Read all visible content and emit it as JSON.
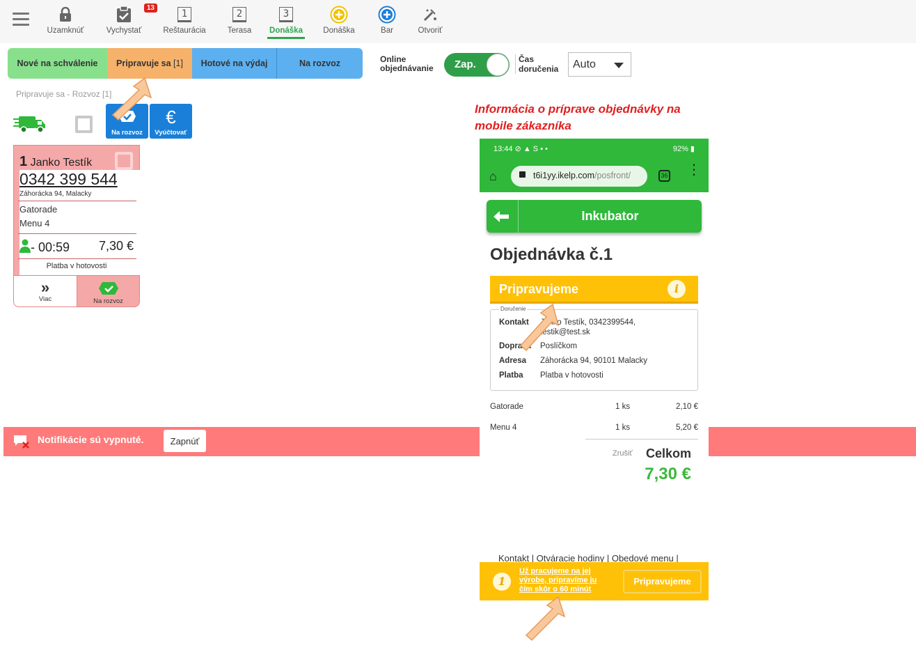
{
  "toolbar": {
    "items": [
      {
        "label": "Uzamknúť",
        "icon": "lock-icon"
      },
      {
        "label": "Vychystať",
        "icon": "clipboard-check-icon",
        "badge": "13"
      },
      {
        "label": "Reštaurácia",
        "icon": "table-1-icon",
        "num": "1"
      },
      {
        "label": "Terasa",
        "icon": "table-2-icon",
        "num": "2"
      },
      {
        "label": "Donáška",
        "icon": "table-3-icon",
        "num": "3"
      },
      {
        "label": "Donáška",
        "icon": "plus-yellow-icon"
      },
      {
        "label": "Bar",
        "icon": "plus-blue-icon"
      },
      {
        "label": "Otvoriť",
        "icon": "open-icon"
      }
    ]
  },
  "tabs": {
    "new": "Nové na schválenie",
    "prep": "Pripravuje sa",
    "prep_count": "[1]",
    "ready": "Hotové na výdaj",
    "delivery": "Na rozvoz"
  },
  "online": {
    "label_line1": "Online",
    "label_line2": "objednávanie",
    "toggle": "Zap."
  },
  "delivery_time": {
    "label_line1": "Čas",
    "label_line2": "doručenia",
    "value": "Auto"
  },
  "section_title": "Pripravuje sa - Rozvoz [1]",
  "actions": {
    "to_delivery": "Na rozvoz",
    "settle": "Vyúčtovať"
  },
  "order": {
    "number": "1",
    "name": "Janko Testík",
    "phone": "0342 399 544",
    "address": "Záhorácka 94, Malacky",
    "items": [
      "Gatorade",
      "Menu 4"
    ],
    "time": "- 00:59",
    "price": "7,30 €",
    "payment": "Platba v hotovosti",
    "more_btn": "Viac",
    "deliver_btn": "Na rozvoz"
  },
  "notification": {
    "text": "Notifikácie sú vypnuté.",
    "button": "Zapnúť"
  },
  "caption": "Informácia o príprave objednávky na mobile zákazníka",
  "phone": {
    "status_left": "13:44 ⊘ ▲ S ▪ •",
    "status_right": "92% ▮",
    "url_domain": "t6i1yy.ikelp.com",
    "url_path": "/posfront/",
    "tabs_count": "36",
    "header_title": "Inkubator",
    "order_title": "Objednávka č.1",
    "status": "Pripravujeme",
    "fieldset_legend": "Doručenie",
    "details": [
      {
        "label": "Kontakt",
        "value": "Janko Testík, 0342399544,",
        "value2": "testik@test.sk"
      },
      {
        "label": "Doprava",
        "value": "Poslíčkom"
      },
      {
        "label": "Adresa",
        "value": "Záhorácka 94, 90101 Malacky"
      },
      {
        "label": "Platba",
        "value": "Platba v hotovosti"
      }
    ],
    "lines": [
      {
        "name": "Gatorade",
        "qty": "1 ks",
        "price": "2,10 €"
      },
      {
        "name": "Menu 4",
        "qty": "1 ks",
        "price": "5,20 €"
      }
    ],
    "cancel": "Zrušiť",
    "total_label": "Celkom",
    "total": "7,30 €",
    "footer_links": "Kontakt | Otváracie hodiny | Obedové menu |",
    "bottom_number": "1",
    "bottom_msg": "Už pracujeme na jej výrobe, pripravíme ju čím skôr o 60 minút",
    "bottom_btn": "Pripravujeme"
  },
  "colors": {
    "green": "#2fb83a",
    "prep": "#f6b26b",
    "ready": "#5cb0f0",
    "new": "#88e08d",
    "card": "#f5a8a8",
    "notif": "#ff7a7a",
    "status": "#ffc107"
  }
}
